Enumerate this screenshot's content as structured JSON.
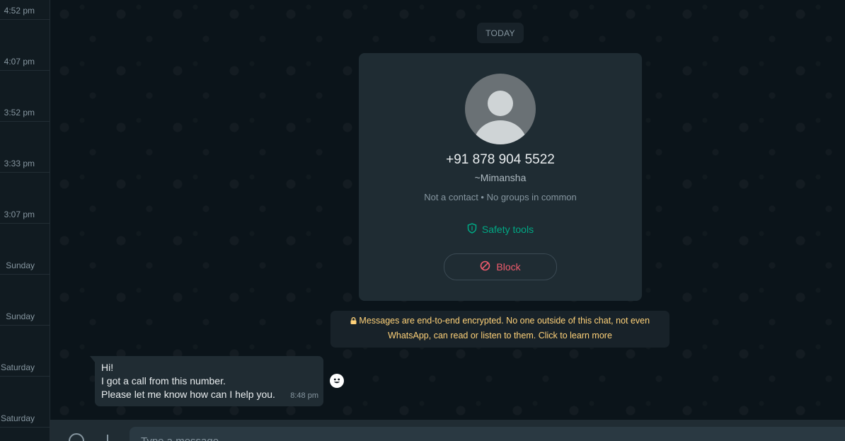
{
  "sidebar": {
    "times": [
      "4:52 pm",
      "4:07 pm",
      "3:52 pm",
      "3:33 pm",
      "3:07 pm",
      "Sunday",
      "Sunday",
      "Saturday",
      "Saturday"
    ]
  },
  "chat": {
    "date_divider": "TODAY",
    "contact_card": {
      "phone": "+91 878 904 5522",
      "name": "~Mimansha",
      "status": "Not a contact • No groups in common",
      "safety_label": "Safety tools",
      "block_label": "Block"
    },
    "encryption_notice": {
      "line1": "Messages are end-to-end encrypted. No one outside of this chat, not even",
      "line2": "WhatsApp, can read or listen to them. Click to learn more"
    },
    "message": {
      "lines": [
        "Hi!",
        "I got a call from this number.",
        "Please let me know how can I help you."
      ],
      "time": "8:48 pm"
    }
  },
  "composer": {
    "placeholder": "Type a message"
  },
  "colors": {
    "accent_green": "#00a884",
    "danger_red": "#f15c6d",
    "notice_yellow": "#ffd279",
    "background": "#0b141a"
  },
  "icons": [
    "default-avatar-icon",
    "shield-icon",
    "block-icon",
    "lock-icon",
    "emoji-reaction-icon",
    "emoji-icon",
    "plus-icon"
  ]
}
